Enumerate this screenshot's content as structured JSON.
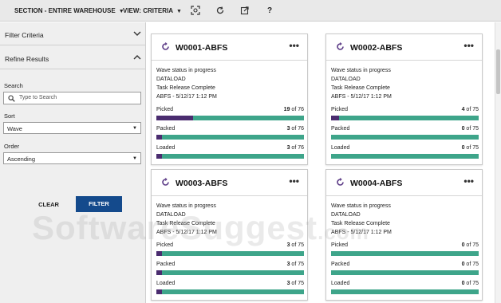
{
  "toolbar": {
    "section_label": "SECTION - ENTIRE WAREHOUSE",
    "view_label": "VIEW: CRITERIA",
    "icons": [
      "focus-icon",
      "refresh-icon",
      "export-icon",
      "help-icon"
    ],
    "help_glyph": "?"
  },
  "left_panel": {
    "filter_criteria": "Filter Criteria",
    "refine_results": "Refine Results",
    "search_label": "Search",
    "search_placeholder": "Type to Search",
    "sort_label": "Sort",
    "sort_value": "Wave",
    "order_label": "Order",
    "order_value": "Ascending",
    "clear_label": "CLEAR",
    "filter_label": "FILTER"
  },
  "colors": {
    "progress_done": "#4a2c6f",
    "progress_remaining": "#3ea58a",
    "filter_button": "#144a8c",
    "spinner": "#5b3a86"
  },
  "cards": [
    {
      "name": "W0001-ABFS",
      "more": "•••",
      "status": "Wave status in progress",
      "source": "DATALOAD",
      "release": "Task Release Complete",
      "stamp": "ABFS - 5/12/17 1:12 PM",
      "metrics": [
        {
          "label": "Picked",
          "done": 19,
          "of": "of 76",
          "fraction": 0.25
        },
        {
          "label": "Packed",
          "done": 3,
          "of": "of 76",
          "fraction": 0.04
        },
        {
          "label": "Loaded",
          "done": 3,
          "of": "of 76",
          "fraction": 0.04
        }
      ]
    },
    {
      "name": "W0002-ABFS",
      "more": "•••",
      "status": "Wave status in progress",
      "source": "DATALOAD",
      "release": "Task Release Complete",
      "stamp": "ABFS - 5/12/17 1:12 PM",
      "metrics": [
        {
          "label": "Picked",
          "done": 4,
          "of": "of 75",
          "fraction": 0.053
        },
        {
          "label": "Packed",
          "done": 0,
          "of": "of 75",
          "fraction": 0.0
        },
        {
          "label": "Loaded",
          "done": 0,
          "of": "of 75",
          "fraction": 0.0
        }
      ]
    },
    {
      "name": "W0003-ABFS",
      "more": "•••",
      "status": "Wave status in progress",
      "source": "DATALOAD",
      "release": "Task Release Complete",
      "stamp": "ABFS - 5/12/17 1:12 PM",
      "metrics": [
        {
          "label": "Picked",
          "done": 3,
          "of": "of 75",
          "fraction": 0.04
        },
        {
          "label": "Packed",
          "done": 3,
          "of": "of 75",
          "fraction": 0.04
        },
        {
          "label": "Loaded",
          "done": 3,
          "of": "of 75",
          "fraction": 0.04
        }
      ]
    },
    {
      "name": "W0004-ABFS",
      "more": "•••",
      "status": "Wave status in progress",
      "source": "DATALOAD",
      "release": "Task Release Complete",
      "stamp": "ABFS - 5/12/17 1:12 PM",
      "metrics": [
        {
          "label": "Picked",
          "done": 0,
          "of": "of 75",
          "fraction": 0.0
        },
        {
          "label": "Packed",
          "done": 0,
          "of": "of 75",
          "fraction": 0.0
        },
        {
          "label": "Loaded",
          "done": 0,
          "of": "of 75",
          "fraction": 0.0
        }
      ]
    }
  ],
  "watermark": {
    "main": "SoftwareSuggest",
    "domain": ".com"
  }
}
